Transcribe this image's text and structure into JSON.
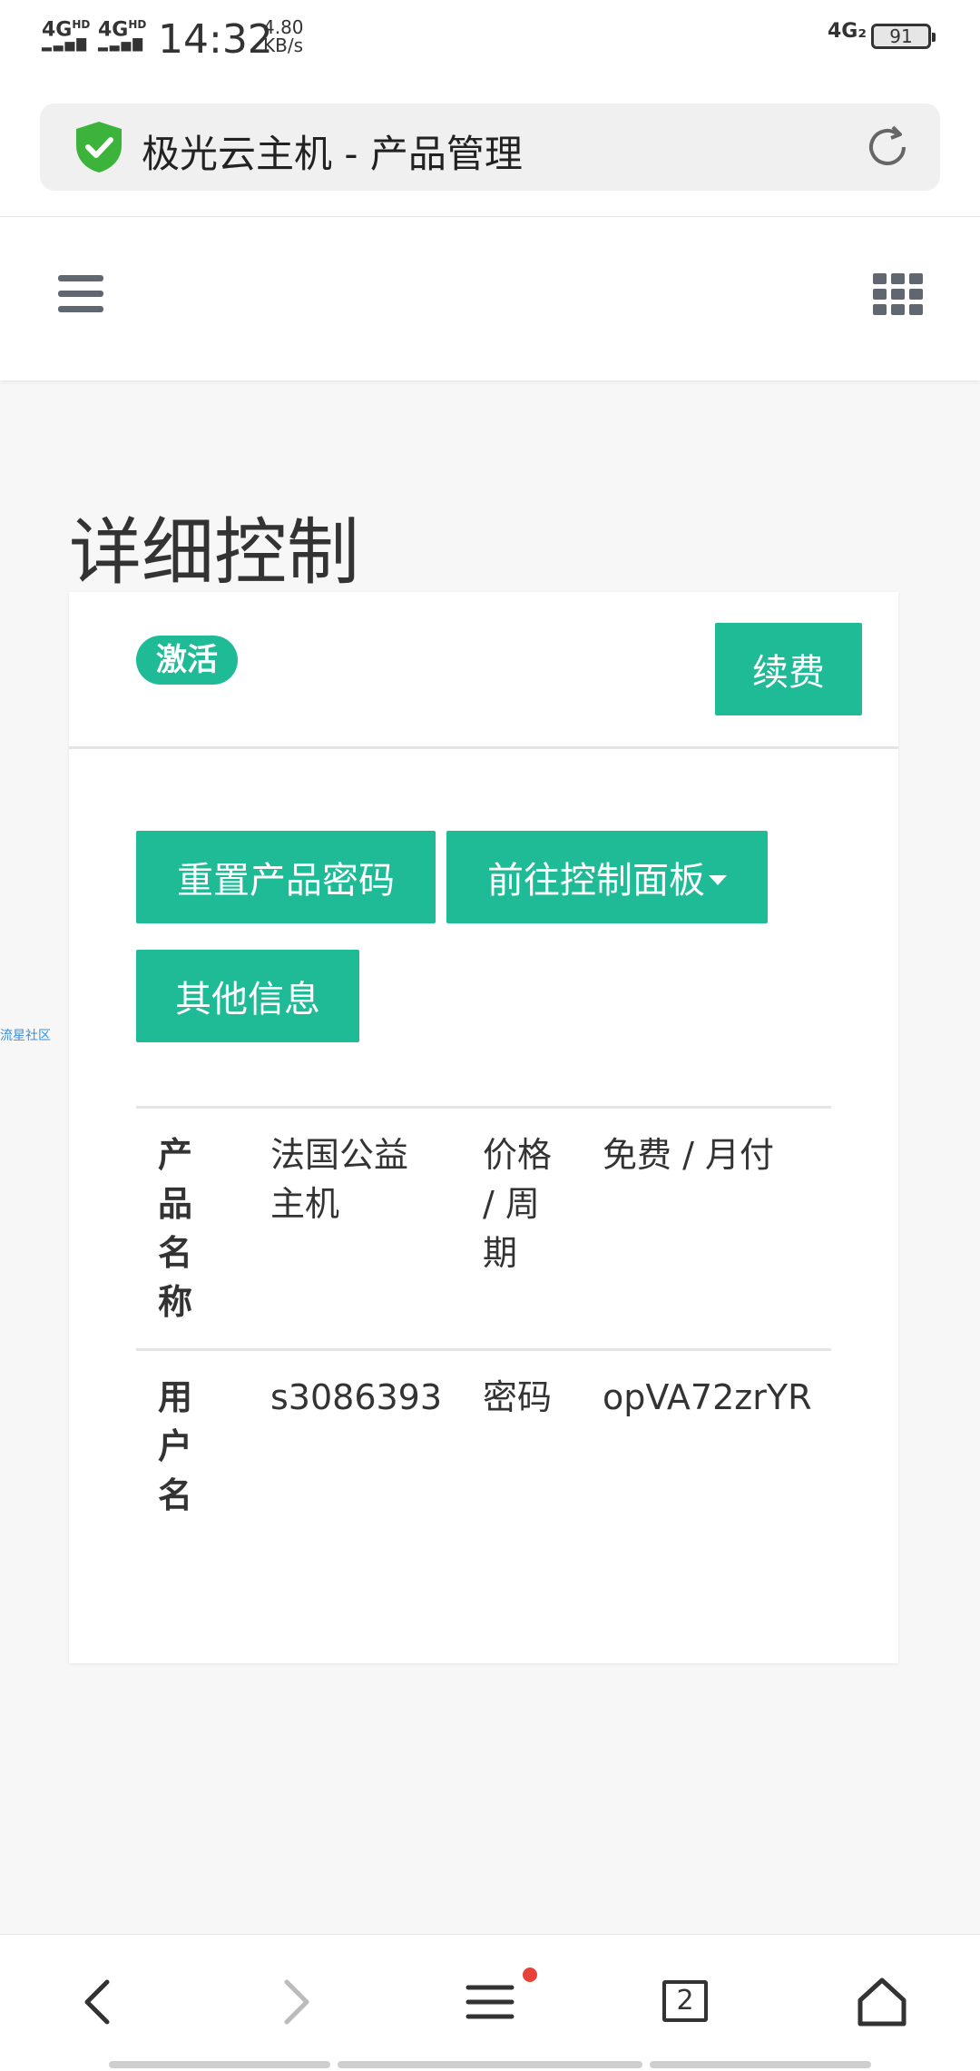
{
  "status_bar": {
    "signal1": "4G",
    "signal1_sup": "HD",
    "signal2": "4G",
    "signal2_sup": "HD",
    "time": "14:32",
    "speed_value": "4.80",
    "speed_unit": "KB/s",
    "network": "4G₂",
    "battery": "91"
  },
  "browser": {
    "title": "极光云主机 - 产品管理",
    "secure_icon": "shield-check-icon",
    "reload_icon": "reload-icon"
  },
  "navbar": {
    "menu_icon": "hamburger-icon",
    "apps_icon": "grid-icon"
  },
  "page": {
    "title": "详细控制"
  },
  "card": {
    "status_badge": "激活",
    "renew_button": "续费",
    "buttons": {
      "reset_password": "重置产品密码",
      "control_panel": "前往控制面板",
      "other_info": "其他信息"
    },
    "table": {
      "row1": {
        "label1": "产品名称",
        "value1": "法国公益主机",
        "label2": "价格 / 周期",
        "value2": "免费 / 月付"
      },
      "row2": {
        "label1": "用户名",
        "value1": "s3086393",
        "label2": "密码",
        "value2": "opVA72zrYR"
      }
    }
  },
  "side_text": "流星社区",
  "bottom_nav": {
    "back": "back-icon",
    "forward": "forward-icon",
    "menu": "menu-icon",
    "tabs_count": "2",
    "home": "home-icon"
  },
  "colors": {
    "accent": "#1fbb96",
    "shield": "#3cb43c",
    "dot": "#e6423a"
  }
}
